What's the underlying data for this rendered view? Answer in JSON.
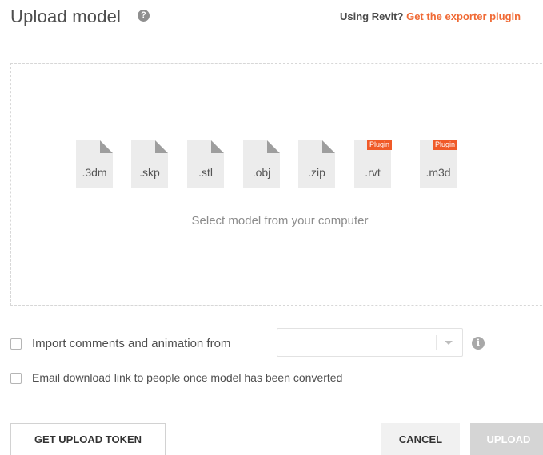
{
  "header": {
    "title": "Upload model",
    "help_icon": "?",
    "revit_prompt": "Using Revit?",
    "revit_link": "Get the exporter plugin"
  },
  "dropzone": {
    "files": [
      {
        "ext": ".3dm",
        "plugin": ""
      },
      {
        "ext": ".skp",
        "plugin": ""
      },
      {
        "ext": ".stl",
        "plugin": ""
      },
      {
        "ext": ".obj",
        "plugin": ""
      },
      {
        "ext": ".zip",
        "plugin": ""
      },
      {
        "ext": ".rvt",
        "plugin": "Plugin"
      },
      {
        "ext": ".m3d",
        "plugin": "Plugin"
      }
    ],
    "select_text": "Select model from your computer"
  },
  "options": {
    "import_label": "Import comments and animation from",
    "import_select_value": "",
    "info_icon": "i",
    "email_label": "Email download link to people once model has been converted"
  },
  "buttons": {
    "token": "GET UPLOAD TOKEN",
    "cancel": "CANCEL",
    "upload": "UPLOAD"
  },
  "colors": {
    "accent": "#f06a35",
    "badge": "#f05a28",
    "upload_disabled": "#d5d5d5"
  }
}
